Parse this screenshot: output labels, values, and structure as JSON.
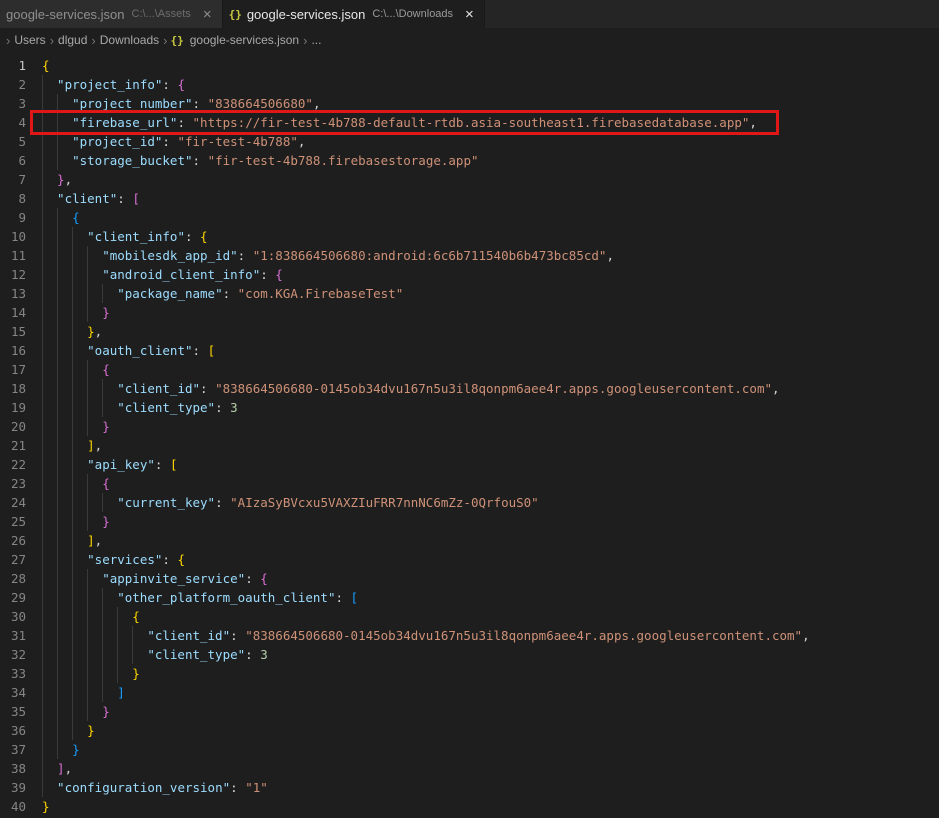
{
  "colors": {
    "background": "#1e1e1e",
    "tabbarBg": "#252526",
    "inactiveTabBg": "#2d2d2d",
    "key": "#9cdcfe",
    "string": "#ce9178",
    "number": "#b5cea8",
    "punct": "#d4d4d4",
    "bracket1": "#ffd700",
    "bracket2": "#da70d6",
    "bracket3": "#179fff",
    "lineNumber": "#858585",
    "lineNumberActive": "#c6c6c6",
    "breadcrumb": "#a9a9a9",
    "guide": "#3a3a3a",
    "jsonIcon": "#cbcb41",
    "annotation": "#e01717"
  },
  "icons": {
    "json": "{}",
    "chevron": "›",
    "close": "×"
  },
  "tabs": [
    {
      "name": "google-services.json",
      "path": "C:\\...\\Assets",
      "active": false
    },
    {
      "name": "google-services.json",
      "path": "C:\\...\\Downloads",
      "active": true
    }
  ],
  "breadcrumbs": [
    "Users",
    "dlgud",
    "Downloads",
    "google-services.json",
    "..."
  ],
  "editor": {
    "active_line": 1,
    "annotation": {
      "line": 4
    },
    "lines": [
      {
        "num": 1,
        "indent": 0,
        "tokens": [
          [
            "{",
            "b1"
          ]
        ]
      },
      {
        "num": 2,
        "indent": 1,
        "tokens": [
          [
            "\"project_info\"",
            "k"
          ],
          [
            ": ",
            "p"
          ],
          [
            "{",
            "b2"
          ]
        ]
      },
      {
        "num": 3,
        "indent": 2,
        "tokens": [
          [
            "\"project_number\"",
            "k"
          ],
          [
            ": ",
            "p"
          ],
          [
            "\"838664506680\"",
            "s"
          ],
          [
            ",",
            "p"
          ]
        ]
      },
      {
        "num": 4,
        "indent": 2,
        "tokens": [
          [
            "\"firebase_url\"",
            "k"
          ],
          [
            ": ",
            "p"
          ],
          [
            "\"https://fir-test-4b788-default-rtdb.asia-southeast1.firebasedatabase.app\"",
            "s"
          ],
          [
            ",",
            "p"
          ]
        ]
      },
      {
        "num": 5,
        "indent": 2,
        "tokens": [
          [
            "\"project_id\"",
            "k"
          ],
          [
            ": ",
            "p"
          ],
          [
            "\"fir-test-4b788\"",
            "s"
          ],
          [
            ",",
            "p"
          ]
        ]
      },
      {
        "num": 6,
        "indent": 2,
        "tokens": [
          [
            "\"storage_bucket\"",
            "k"
          ],
          [
            ": ",
            "p"
          ],
          [
            "\"fir-test-4b788.firebasestorage.app\"",
            "s"
          ]
        ]
      },
      {
        "num": 7,
        "indent": 1,
        "tokens": [
          [
            "}",
            "b2"
          ],
          [
            ",",
            "p"
          ]
        ]
      },
      {
        "num": 8,
        "indent": 1,
        "tokens": [
          [
            "\"client\"",
            "k"
          ],
          [
            ": ",
            "p"
          ],
          [
            "[",
            "b2"
          ]
        ]
      },
      {
        "num": 9,
        "indent": 2,
        "tokens": [
          [
            "{",
            "b3"
          ]
        ]
      },
      {
        "num": 10,
        "indent": 3,
        "tokens": [
          [
            "\"client_info\"",
            "k"
          ],
          [
            ": ",
            "p"
          ],
          [
            "{",
            "b1"
          ]
        ]
      },
      {
        "num": 11,
        "indent": 4,
        "tokens": [
          [
            "\"mobilesdk_app_id\"",
            "k"
          ],
          [
            ": ",
            "p"
          ],
          [
            "\"1:838664506680:android:6c6b711540b6b473bc85cd\"",
            "s"
          ],
          [
            ",",
            "p"
          ]
        ]
      },
      {
        "num": 12,
        "indent": 4,
        "tokens": [
          [
            "\"android_client_info\"",
            "k"
          ],
          [
            ": ",
            "p"
          ],
          [
            "{",
            "b2"
          ]
        ]
      },
      {
        "num": 13,
        "indent": 5,
        "tokens": [
          [
            "\"package_name\"",
            "k"
          ],
          [
            ": ",
            "p"
          ],
          [
            "\"com.KGA.FirebaseTest\"",
            "s"
          ]
        ]
      },
      {
        "num": 14,
        "indent": 4,
        "tokens": [
          [
            "}",
            "b2"
          ]
        ]
      },
      {
        "num": 15,
        "indent": 3,
        "tokens": [
          [
            "}",
            "b1"
          ],
          [
            ",",
            "p"
          ]
        ]
      },
      {
        "num": 16,
        "indent": 3,
        "tokens": [
          [
            "\"oauth_client\"",
            "k"
          ],
          [
            ": ",
            "p"
          ],
          [
            "[",
            "b1"
          ]
        ]
      },
      {
        "num": 17,
        "indent": 4,
        "tokens": [
          [
            "{",
            "b2"
          ]
        ]
      },
      {
        "num": 18,
        "indent": 5,
        "tokens": [
          [
            "\"client_id\"",
            "k"
          ],
          [
            ": ",
            "p"
          ],
          [
            "\"838664506680-0145ob34dvu167n5u3il8qonpm6aee4r.apps.googleusercontent.com\"",
            "s"
          ],
          [
            ",",
            "p"
          ]
        ]
      },
      {
        "num": 19,
        "indent": 5,
        "tokens": [
          [
            "\"client_type\"",
            "k"
          ],
          [
            ": ",
            "p"
          ],
          [
            "3",
            "n"
          ]
        ]
      },
      {
        "num": 20,
        "indent": 4,
        "tokens": [
          [
            "}",
            "b2"
          ]
        ]
      },
      {
        "num": 21,
        "indent": 3,
        "tokens": [
          [
            "]",
            "b1"
          ],
          [
            ",",
            "p"
          ]
        ]
      },
      {
        "num": 22,
        "indent": 3,
        "tokens": [
          [
            "\"api_key\"",
            "k"
          ],
          [
            ": ",
            "p"
          ],
          [
            "[",
            "b1"
          ]
        ]
      },
      {
        "num": 23,
        "indent": 4,
        "tokens": [
          [
            "{",
            "b2"
          ]
        ]
      },
      {
        "num": 24,
        "indent": 5,
        "tokens": [
          [
            "\"current_key\"",
            "k"
          ],
          [
            ": ",
            "p"
          ],
          [
            "\"AIzaSyBVcxu5VAXZIuFRR7nnNC6mZz-0QrfouS0\"",
            "s"
          ]
        ]
      },
      {
        "num": 25,
        "indent": 4,
        "tokens": [
          [
            "}",
            "b2"
          ]
        ]
      },
      {
        "num": 26,
        "indent": 3,
        "tokens": [
          [
            "]",
            "b1"
          ],
          [
            ",",
            "p"
          ]
        ]
      },
      {
        "num": 27,
        "indent": 3,
        "tokens": [
          [
            "\"services\"",
            "k"
          ],
          [
            ": ",
            "p"
          ],
          [
            "{",
            "b1"
          ]
        ]
      },
      {
        "num": 28,
        "indent": 4,
        "tokens": [
          [
            "\"appinvite_service\"",
            "k"
          ],
          [
            ": ",
            "p"
          ],
          [
            "{",
            "b2"
          ]
        ]
      },
      {
        "num": 29,
        "indent": 5,
        "tokens": [
          [
            "\"other_platform_oauth_client\"",
            "k"
          ],
          [
            ": ",
            "p"
          ],
          [
            "[",
            "b3"
          ]
        ]
      },
      {
        "num": 30,
        "indent": 6,
        "tokens": [
          [
            "{",
            "b1"
          ]
        ]
      },
      {
        "num": 31,
        "indent": 7,
        "tokens": [
          [
            "\"client_id\"",
            "k"
          ],
          [
            ": ",
            "p"
          ],
          [
            "\"838664506680-0145ob34dvu167n5u3il8qonpm6aee4r.apps.googleusercontent.com\"",
            "s"
          ],
          [
            ",",
            "p"
          ]
        ]
      },
      {
        "num": 32,
        "indent": 7,
        "tokens": [
          [
            "\"client_type\"",
            "k"
          ],
          [
            ": ",
            "p"
          ],
          [
            "3",
            "n"
          ]
        ]
      },
      {
        "num": 33,
        "indent": 6,
        "tokens": [
          [
            "}",
            "b1"
          ]
        ]
      },
      {
        "num": 34,
        "indent": 5,
        "tokens": [
          [
            "]",
            "b3"
          ]
        ]
      },
      {
        "num": 35,
        "indent": 4,
        "tokens": [
          [
            "}",
            "b2"
          ]
        ]
      },
      {
        "num": 36,
        "indent": 3,
        "tokens": [
          [
            "}",
            "b1"
          ]
        ]
      },
      {
        "num": 37,
        "indent": 2,
        "tokens": [
          [
            "}",
            "b3"
          ]
        ]
      },
      {
        "num": 38,
        "indent": 1,
        "tokens": [
          [
            "]",
            "b2"
          ],
          [
            ",",
            "p"
          ]
        ]
      },
      {
        "num": 39,
        "indent": 1,
        "tokens": [
          [
            "\"configuration_version\"",
            "k"
          ],
          [
            ": ",
            "p"
          ],
          [
            "\"1\"",
            "s"
          ]
        ]
      },
      {
        "num": 40,
        "indent": 0,
        "tokens": [
          [
            "}",
            "b1"
          ]
        ]
      }
    ]
  }
}
